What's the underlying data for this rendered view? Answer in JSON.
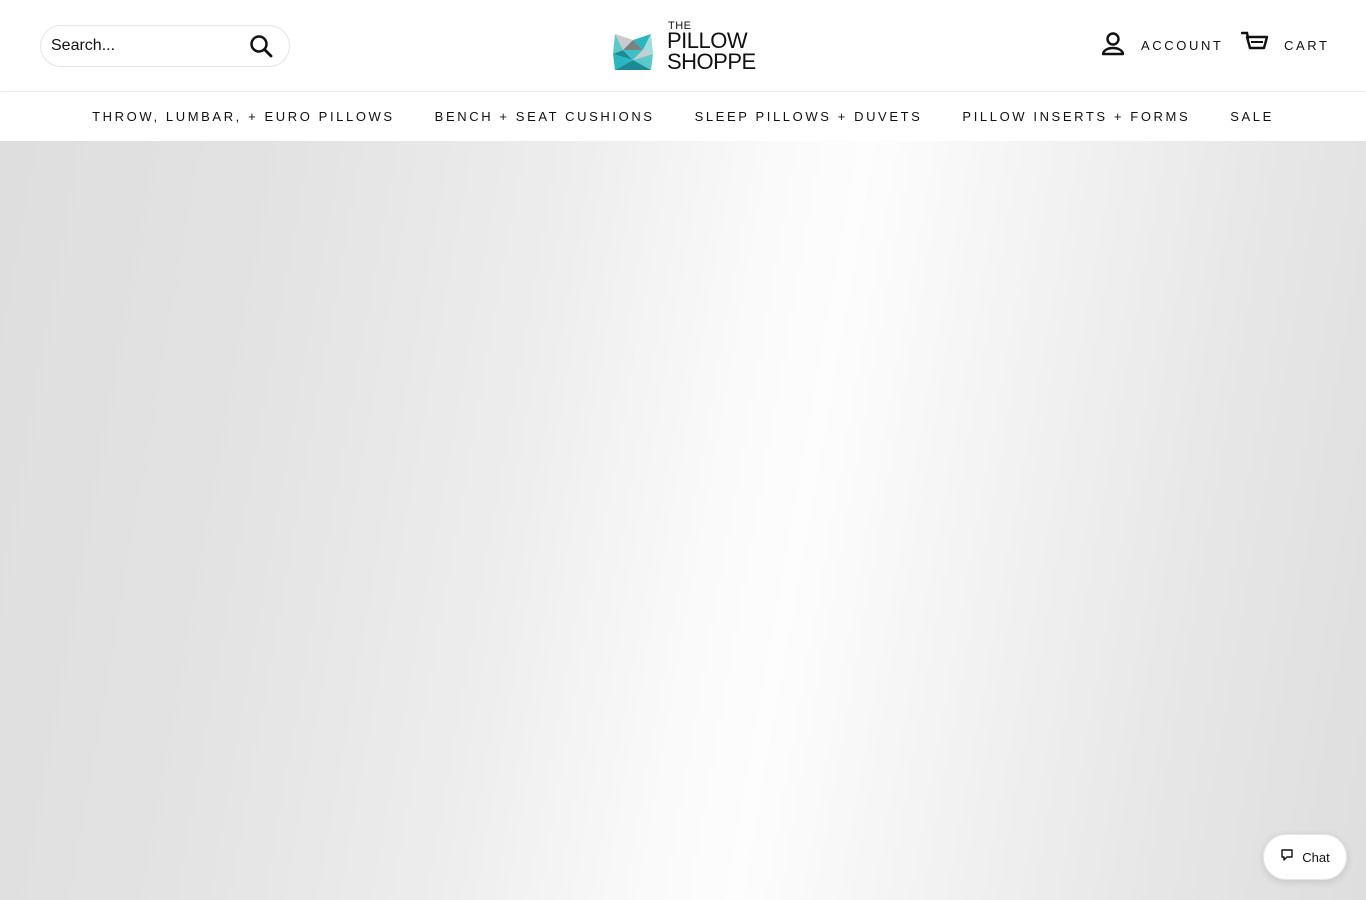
{
  "header": {
    "search": {
      "placeholder": "Search...",
      "button_icon": "search-icon"
    },
    "logo": {
      "line_the": "THE",
      "line1": "PILLOW",
      "line2": "SHOPPE",
      "colors": [
        "#2bb5be",
        "#5cc8c9",
        "#7a8084",
        "#c9cccf",
        "#1a8a93"
      ]
    },
    "account": {
      "label": "ACCOUNT",
      "icon": "user-icon"
    },
    "cart": {
      "label": "CART",
      "icon": "cart-icon"
    }
  },
  "nav": {
    "items": [
      {
        "label": "THROW, LUMBAR, + EURO PILLOWS"
      },
      {
        "label": "BENCH + SEAT CUSHIONS"
      },
      {
        "label": "SLEEP PILLOWS + DUVETS"
      },
      {
        "label": "PILLOW INSERTS + FORMS"
      },
      {
        "label": "SALE"
      }
    ]
  },
  "chat": {
    "label": "Chat",
    "icon": "chat-bubble-icon"
  }
}
